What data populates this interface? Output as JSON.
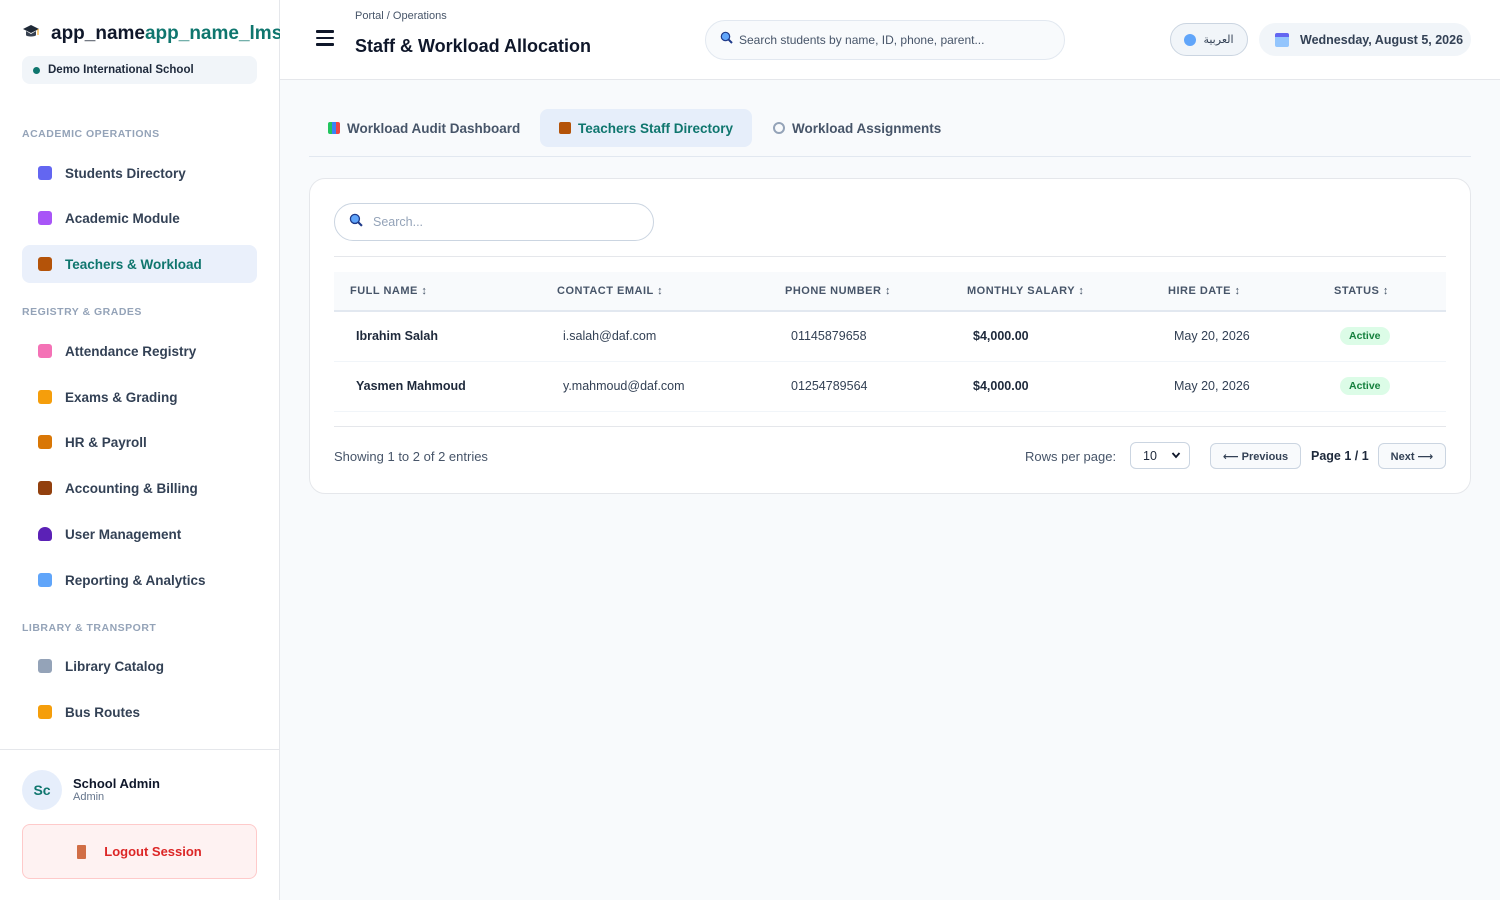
{
  "brand": {
    "name_a": "app_name",
    "name_b": "app_name_lms"
  },
  "school": "Demo International School",
  "sidebar": {
    "sections": [
      {
        "title": "ACADEMIC OPERATIONS"
      },
      {
        "title": "REGISTRY & GRADES"
      },
      {
        "title": "LIBRARY & TRANSPORT"
      }
    ],
    "items": [
      {
        "label": "Students Directory",
        "icon": "students-icon",
        "color": "#6366f1"
      },
      {
        "label": "Academic Module",
        "icon": "books-icon",
        "color": "#a855f7"
      },
      {
        "label": "Teachers & Workload",
        "icon": "teachers-icon",
        "color": "#b45309"
      },
      {
        "label": "Attendance Registry",
        "icon": "attendance-icon",
        "color": "#f472b6"
      },
      {
        "label": "Exams & Grading",
        "icon": "trophy-icon",
        "color": "#f59e0b"
      },
      {
        "label": "HR & Payroll",
        "icon": "hr-icon",
        "color": "#d97706"
      },
      {
        "label": "Accounting & Billing",
        "icon": "briefcase-icon",
        "color": "#92400e"
      },
      {
        "label": "User Management",
        "icon": "user-icon",
        "color": "#5b21b6"
      },
      {
        "label": "Reporting & Analytics",
        "icon": "chart-icon",
        "color": "#60a5fa"
      },
      {
        "label": "Library Catalog",
        "icon": "book-open-icon",
        "color": "#94a3b8"
      },
      {
        "label": "Bus Routes",
        "icon": "bus-icon",
        "color": "#f59e0b"
      }
    ]
  },
  "user": {
    "initials": "Sc",
    "name": "School Admin",
    "role": "Admin"
  },
  "logout_label": "Logout Session",
  "header": {
    "breadcrumb": "Portal / Operations",
    "title": "Staff & Workload Allocation",
    "search_placeholder": "Search students by name, ID, phone, parent...",
    "lang_label": "العربية",
    "date": "Wednesday, August 5, 2026"
  },
  "tabs": [
    {
      "label": "Workload Audit Dashboard"
    },
    {
      "label": "Teachers Staff Directory"
    },
    {
      "label": "Workload Assignments"
    }
  ],
  "table": {
    "search_placeholder": "Search...",
    "columns": [
      "FULL NAME ↕",
      "CONTACT EMAIL ↕",
      "PHONE NUMBER ↕",
      "MONTHLY SALARY ↕",
      "HIRE DATE ↕",
      "STATUS ↕"
    ],
    "rows": [
      {
        "name": "Ibrahim Salah",
        "email": "i.salah@daf.com",
        "phone": "01145879658",
        "salary": "$4,000.00",
        "hire_date": "May 20, 2026",
        "status": "Active"
      },
      {
        "name": "Yasmen Mahmoud",
        "email": "y.mahmoud@daf.com",
        "phone": "01254789564",
        "salary": "$4,000.00",
        "hire_date": "May 20, 2026",
        "status": "Active"
      }
    ]
  },
  "pagination": {
    "showing": "Showing 1 to 2 of 2 entries",
    "rows_per_page_label": "Rows per page:",
    "rows_per_page": "10",
    "prev": "⟵ Previous",
    "page": "Page 1 / 1",
    "next": "Next ⟶"
  }
}
